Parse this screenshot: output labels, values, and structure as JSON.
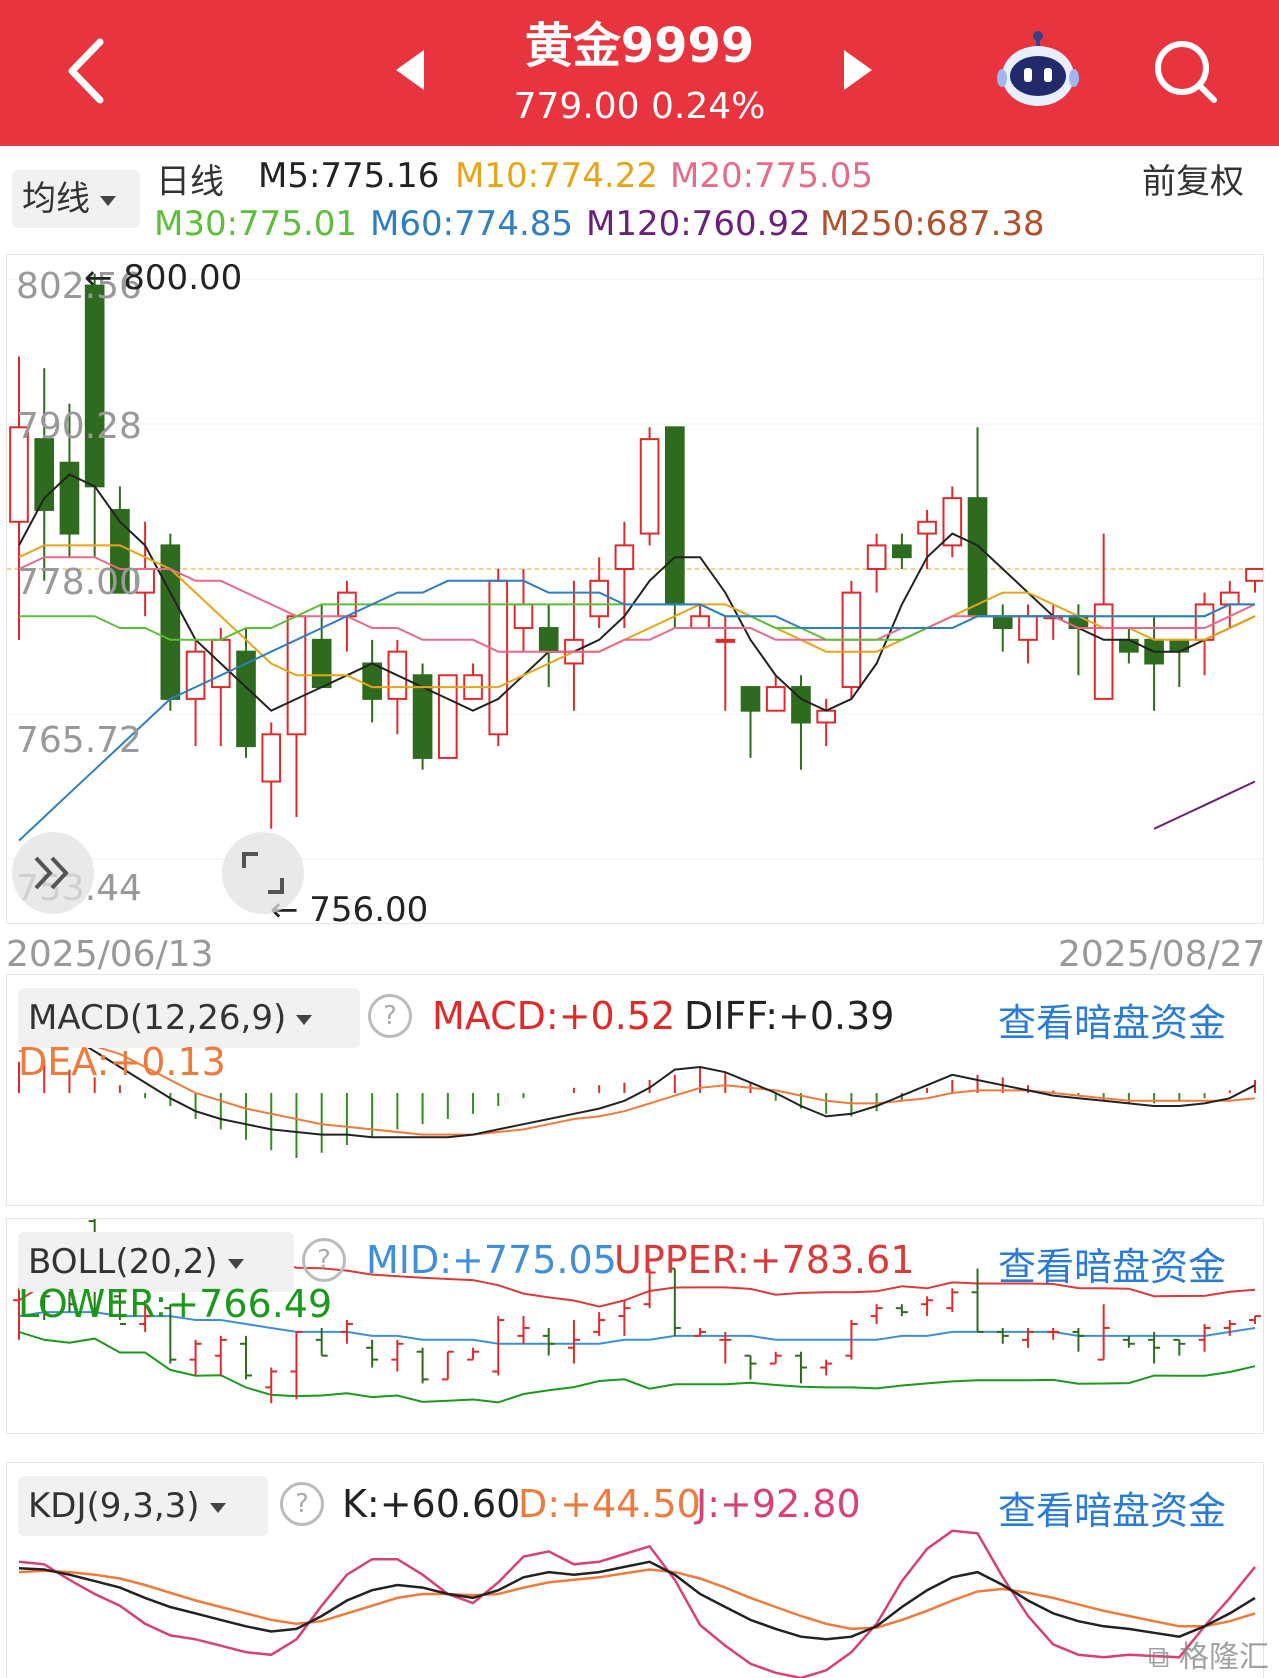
{
  "header": {
    "title": "黄金9999",
    "price_line": "779.00 0.24%",
    "back_icon": "chevron-left-icon",
    "prev_icon": "triangle-left-icon",
    "next_icon": "triangle-right-icon",
    "robot_icon": "robot-assistant-icon",
    "search_icon": "search-icon"
  },
  "ma_bar": {
    "selector_label": "均线",
    "period": "日线",
    "adjust": "前复权",
    "items": [
      {
        "text": "M5:775.16",
        "color": "#222222"
      },
      {
        "text": "M10:774.22",
        "color": "#e8a419"
      },
      {
        "text": "M20:775.05",
        "color": "#e86a8a"
      },
      {
        "text": "M30:775.01",
        "color": "#5cbf3a"
      },
      {
        "text": "M60:774.85",
        "color": "#2f7ec1"
      },
      {
        "text": "M120:760.92",
        "color": "#6b1f7b"
      },
      {
        "text": "M250:687.38",
        "color": "#b0502c"
      }
    ]
  },
  "main_chart": {
    "y_labels": [
      "802.56",
      "790.28",
      "778.00",
      "765.72",
      "753.44"
    ],
    "high_marker": "800.00",
    "low_marker": "756.00",
    "date_start": "2025/06/13",
    "date_end": "2025/08/27",
    "ylim": [
      753.44,
      802.56
    ],
    "candles": [
      {
        "o": 782,
        "h": 796,
        "l": 772,
        "c": 790
      },
      {
        "o": 789,
        "h": 795,
        "l": 777,
        "c": 783
      },
      {
        "o": 787,
        "h": 792,
        "l": 779,
        "c": 781
      },
      {
        "o": 802,
        "h": 803,
        "l": 779,
        "c": 785
      },
      {
        "o": 783,
        "h": 785,
        "l": 777,
        "c": 776
      },
      {
        "o": 776,
        "h": 782,
        "l": 774,
        "c": 778
      },
      {
        "o": 780,
        "h": 781,
        "l": 766,
        "c": 767
      },
      {
        "o": 767,
        "h": 772,
        "l": 763,
        "c": 771
      },
      {
        "o": 768,
        "h": 773,
        "l": 763,
        "c": 772
      },
      {
        "o": 771,
        "h": 773,
        "l": 762,
        "c": 763
      },
      {
        "o": 760,
        "h": 765,
        "l": 756,
        "c": 764
      },
      {
        "o": 764,
        "h": 774,
        "l": 757,
        "c": 774
      },
      {
        "o": 772,
        "h": 775,
        "l": 768,
        "c": 768
      },
      {
        "o": 774,
        "h": 777,
        "l": 771,
        "c": 776
      },
      {
        "o": 770,
        "h": 772,
        "l": 765,
        "c": 767
      },
      {
        "o": 767,
        "h": 772,
        "l": 764,
        "c": 771
      },
      {
        "o": 769,
        "h": 770,
        "l": 761,
        "c": 762
      },
      {
        "o": 762,
        "h": 769,
        "l": 762,
        "c": 769
      },
      {
        "o": 767,
        "h": 770,
        "l": 767,
        "c": 769
      },
      {
        "o": 764,
        "h": 778,
        "l": 763,
        "c": 777
      },
      {
        "o": 773,
        "h": 778,
        "l": 771,
        "c": 775
      },
      {
        "o": 773,
        "h": 775,
        "l": 768,
        "c": 771
      },
      {
        "o": 770,
        "h": 777,
        "l": 766,
        "c": 772
      },
      {
        "o": 774,
        "h": 779,
        "l": 773,
        "c": 777
      },
      {
        "o": 778,
        "h": 782,
        "l": 773,
        "c": 780
      },
      {
        "o": 781,
        "h": 790,
        "l": 780,
        "c": 789
      },
      {
        "o": 790,
        "h": 790,
        "l": 773,
        "c": 775
      },
      {
        "o": 773,
        "h": 775,
        "l": 773,
        "c": 774
      },
      {
        "o": 772,
        "h": 774,
        "l": 766,
        "c": 772
      },
      {
        "o": 768,
        "h": 768,
        "l": 762,
        "c": 766
      },
      {
        "o": 766,
        "h": 769,
        "l": 766,
        "c": 768
      },
      {
        "o": 768,
        "h": 769,
        "l": 761,
        "c": 765
      },
      {
        "o": 765,
        "h": 767,
        "l": 763,
        "c": 766
      },
      {
        "o": 768,
        "h": 777,
        "l": 767,
        "c": 776
      },
      {
        "o": 778,
        "h": 781,
        "l": 776,
        "c": 780
      },
      {
        "o": 780,
        "h": 781,
        "l": 778,
        "c": 779
      },
      {
        "o": 781,
        "h": 783,
        "l": 778,
        "c": 782
      },
      {
        "o": 780,
        "h": 785,
        "l": 779,
        "c": 784
      },
      {
        "o": 784,
        "h": 790,
        "l": 774,
        "c": 774
      },
      {
        "o": 774,
        "h": 775,
        "l": 771,
        "c": 773
      },
      {
        "o": 772,
        "h": 775,
        "l": 770,
        "c": 774
      },
      {
        "o": 774,
        "h": 775,
        "l": 772,
        "c": 774
      },
      {
        "o": 774,
        "h": 775,
        "l": 769,
        "c": 773
      },
      {
        "o": 767,
        "h": 781,
        "l": 767,
        "c": 775
      },
      {
        "o": 772,
        "h": 773,
        "l": 770,
        "c": 771
      },
      {
        "o": 772,
        "h": 774,
        "l": 766,
        "c": 770
      },
      {
        "o": 772,
        "h": 772,
        "l": 768,
        "c": 771
      },
      {
        "o": 772,
        "h": 776,
        "l": 769,
        "c": 775
      },
      {
        "o": 775,
        "h": 777,
        "l": 773,
        "c": 776
      },
      {
        "o": 777,
        "h": 778,
        "l": 776,
        "c": 778
      }
    ],
    "ma_lines": [
      {
        "name": "M5",
        "color": "#222222",
        "values": [
          780,
          784,
          786,
          785,
          782,
          780,
          776,
          772,
          770,
          768,
          766,
          767,
          768,
          769,
          770,
          769,
          768,
          767,
          766,
          767,
          769,
          771,
          771,
          772,
          774,
          777,
          779,
          779,
          776,
          772,
          769,
          767,
          766,
          767,
          770,
          775,
          779,
          781,
          780,
          778,
          776,
          774,
          773,
          772,
          772,
          771,
          771,
          772,
          773,
          774
        ]
      },
      {
        "name": "M10",
        "color": "#e8a419",
        "values": [
          779,
          780,
          780,
          780,
          780,
          779,
          778,
          776,
          774,
          772,
          770,
          769,
          769,
          769,
          768,
          768,
          768,
          768,
          768,
          768,
          769,
          770,
          771,
          771,
          772,
          773,
          774,
          775,
          775,
          774,
          773,
          772,
          771,
          771,
          771,
          772,
          773,
          774,
          775,
          776,
          776,
          775,
          774,
          773,
          773,
          772,
          772,
          772,
          773,
          774
        ]
      },
      {
        "name": "M20",
        "color": "#e86a8a",
        "values": [
          778,
          779,
          779,
          779,
          778,
          778,
          778,
          777,
          777,
          776,
          775,
          774,
          774,
          774,
          773,
          773,
          772,
          772,
          772,
          771,
          771,
          771,
          771,
          771,
          772,
          772,
          773,
          773,
          773,
          773,
          772,
          772,
          772,
          772,
          772,
          773,
          773,
          774,
          774,
          774,
          774,
          774,
          773,
          773,
          773,
          773,
          773,
          773,
          774,
          775
        ]
      },
      {
        "name": "M30",
        "color": "#5cbf3a",
        "values": [
          774,
          774,
          774,
          774,
          773,
          773,
          772,
          772,
          772,
          773,
          773,
          774,
          775,
          775,
          775,
          775,
          775,
          775,
          775,
          775,
          775,
          775,
          775,
          775,
          775,
          775,
          775,
          775,
          774,
          774,
          773,
          773,
          772,
          772,
          772,
          772,
          773,
          773,
          774,
          774,
          774,
          774,
          774,
          774,
          774,
          774,
          774,
          774,
          775,
          775
        ]
      },
      {
        "name": "M60",
        "color": "#2f7ec1",
        "values": [
          755,
          757,
          759,
          761,
          763,
          765,
          767,
          768,
          769,
          770,
          771,
          772,
          773,
          774,
          775,
          776,
          776,
          777,
          777,
          777,
          777,
          776,
          776,
          776,
          775,
          775,
          775,
          775,
          774,
          774,
          774,
          773,
          773,
          773,
          773,
          773,
          773,
          773,
          774,
          774,
          774,
          774,
          774,
          774,
          774,
          774,
          774,
          774,
          775,
          775
        ]
      },
      {
        "name": "M120",
        "color": "#6b1f7b",
        "values": [
          null,
          null,
          null,
          null,
          null,
          null,
          null,
          null,
          null,
          null,
          null,
          null,
          null,
          null,
          null,
          null,
          null,
          null,
          null,
          null,
          null,
          null,
          null,
          null,
          null,
          null,
          null,
          null,
          null,
          null,
          null,
          null,
          null,
          null,
          null,
          null,
          null,
          null,
          null,
          null,
          null,
          null,
          null,
          null,
          null,
          756,
          757,
          758,
          759,
          760
        ]
      }
    ]
  },
  "macd": {
    "selector_label": "MACD(12,26,9)",
    "macd_text": "MACD:+0.52",
    "diff_text": "DIFF:+0.39",
    "dea_text": "DEA:+0.13",
    "link": "查看暗盘资金",
    "hist": [
      1.2,
      1.3,
      0.9,
      0.6,
      0.3,
      -0.2,
      -0.5,
      -1.0,
      -1.4,
      -1.8,
      -2.2,
      -2.5,
      -2.3,
      -2.0,
      -1.7,
      -1.4,
      -1.2,
      -1.0,
      -0.8,
      -0.5,
      -0.2,
      0.0,
      0.2,
      0.3,
      0.4,
      0.5,
      0.7,
      1.0,
      0.8,
      0.4,
      -0.3,
      -0.6,
      -0.8,
      -0.9,
      -0.7,
      -0.3,
      0.2,
      0.5,
      0.7,
      0.6,
      0.3,
      0.1,
      -0.1,
      -0.3,
      -0.4,
      -0.4,
      -0.3,
      -0.2,
      0.1,
      0.5
    ],
    "diff": [
      2.5,
      2.4,
      2.2,
      1.6,
      1.0,
      0.4,
      -0.2,
      -0.7,
      -1.0,
      -1.2,
      -1.4,
      -1.5,
      -1.6,
      -1.6,
      -1.7,
      -1.7,
      -1.7,
      -1.7,
      -1.6,
      -1.4,
      -1.2,
      -1.0,
      -0.8,
      -0.6,
      -0.3,
      0.2,
      0.9,
      1.0,
      0.8,
      0.4,
      0.0,
      -0.5,
      -0.9,
      -0.8,
      -0.5,
      -0.1,
      0.3,
      0.7,
      0.5,
      0.3,
      0.1,
      -0.1,
      -0.2,
      -0.3,
      -0.4,
      -0.5,
      -0.5,
      -0.4,
      -0.2,
      0.3
    ],
    "dea": [
      1.6,
      1.9,
      2.0,
      1.8,
      1.5,
      1.0,
      0.5,
      0.0,
      -0.3,
      -0.6,
      -0.8,
      -1.0,
      -1.2,
      -1.3,
      -1.4,
      -1.5,
      -1.6,
      -1.6,
      -1.6,
      -1.5,
      -1.4,
      -1.2,
      -1.0,
      -0.9,
      -0.7,
      -0.4,
      -0.1,
      0.2,
      0.3,
      0.2,
      0.1,
      -0.1,
      -0.3,
      -0.4,
      -0.4,
      -0.3,
      -0.2,
      0.0,
      0.1,
      0.1,
      0.1,
      0.0,
      -0.1,
      -0.2,
      -0.3,
      -0.3,
      -0.3,
      -0.3,
      -0.3,
      -0.2
    ]
  },
  "boll": {
    "selector_label": "BOLL(20,2)",
    "mid_text": "MID:+775.05",
    "upper_text": "UPPER:+783.61",
    "lower_text": "LOWER:+766.49",
    "link": "查看暗盘资金"
  },
  "kdj": {
    "selector_label": "KDJ(9,3,3)",
    "k_text": "K:+60.60",
    "d_text": "D:+44.50",
    "j_text": "J:+92.80",
    "link": "查看暗盘资金",
    "k": [
      75,
      74,
      70,
      65,
      60,
      52,
      45,
      40,
      35,
      30,
      26,
      28,
      38,
      50,
      58,
      62,
      60,
      55,
      52,
      58,
      68,
      72,
      70,
      72,
      76,
      80,
      70,
      55,
      45,
      35,
      28,
      22,
      20,
      22,
      30,
      45,
      58,
      68,
      72,
      62,
      50,
      40,
      34,
      30,
      28,
      25,
      22,
      30,
      40,
      52
    ],
    "d": [
      72,
      73,
      72,
      70,
      67,
      62,
      56,
      50,
      45,
      40,
      35,
      32,
      34,
      40,
      46,
      52,
      55,
      55,
      54,
      55,
      60,
      64,
      66,
      68,
      71,
      74,
      72,
      67,
      60,
      52,
      45,
      38,
      32,
      28,
      29,
      35,
      42,
      50,
      57,
      59,
      56,
      52,
      47,
      42,
      38,
      34,
      30,
      30,
      34,
      40
    ],
    "j": [
      80,
      78,
      66,
      55,
      46,
      32,
      23,
      20,
      15,
      10,
      8,
      20,
      46,
      70,
      82,
      82,
      70,
      55,
      48,
      64,
      84,
      88,
      78,
      80,
      86,
      92,
      66,
      31,
      15,
      1,
      -6,
      -10,
      -4,
      10,
      32,
      65,
      90,
      104,
      102,
      68,
      38,
      16,
      8,
      6,
      8,
      7,
      6,
      30,
      52,
      76
    ]
  },
  "zoom_icon": "double-chevron-right-icon",
  "fullscreen_icon": "fullscreen-corner-icon",
  "watermark": "格隆汇",
  "colors": {
    "header_bg": "#e8343f",
    "up": "#e02a2a",
    "down": "#2f6b1f",
    "link": "#2a7bd6",
    "boll_upper": "#d93a3a",
    "boll_mid": "#3f8ed9",
    "boll_lower": "#1a9a1a",
    "macd_up": "#e02a2a",
    "macd_down": "#2f8f1f",
    "dea_line": "#ee7a3b",
    "diff_line": "#222222",
    "kdj_j": "#d9407a",
    "kdj_d": "#ee7a3b",
    "kdj_k": "#222222"
  }
}
